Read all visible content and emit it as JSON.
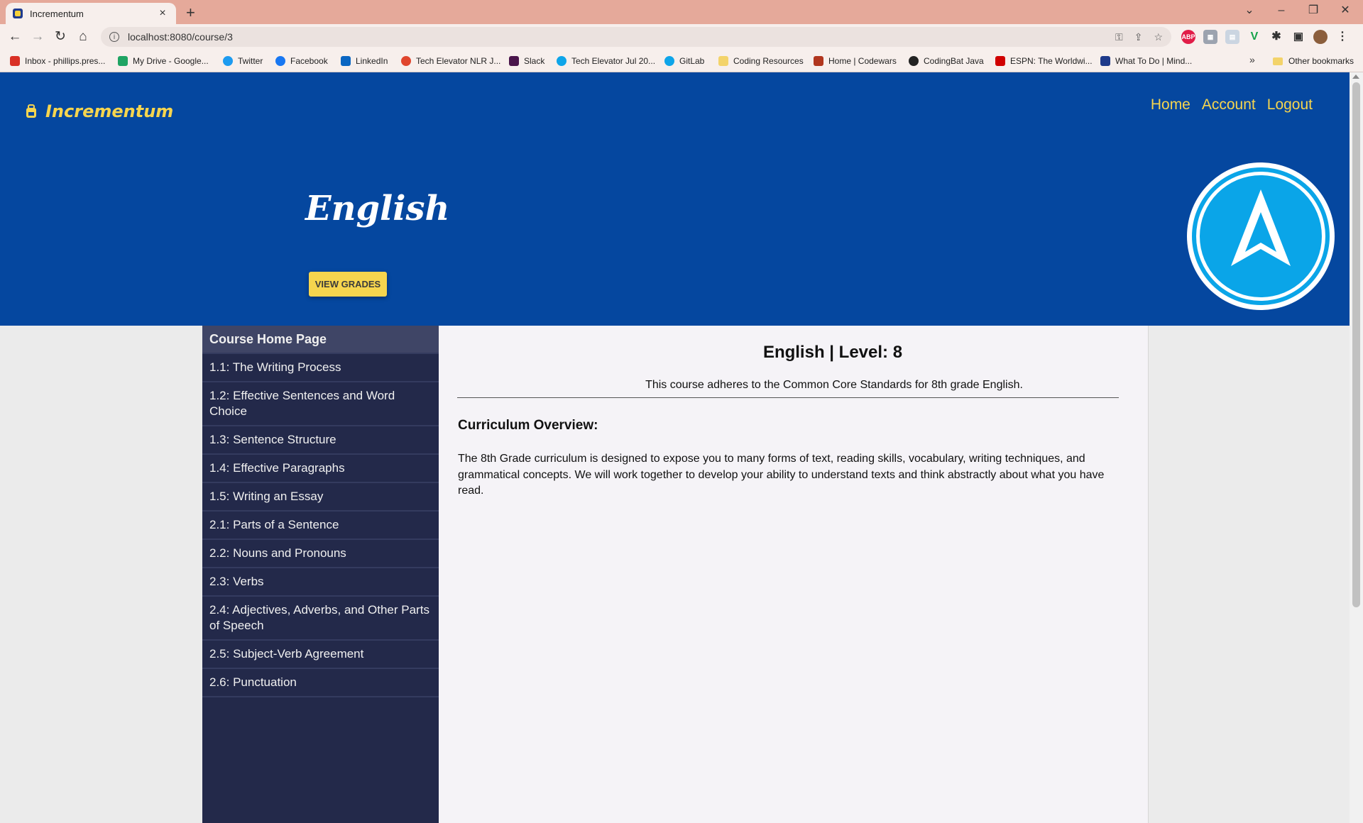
{
  "browser": {
    "tab_title": "Incrementum",
    "tab_close": "×",
    "new_tab": "+",
    "url": "localhost:8080/course/3",
    "bookmarks": [
      {
        "label": "Inbox - phillips.pres...",
        "color": "#d93025"
      },
      {
        "label": "My Drive - Google...",
        "color": "#1fa463"
      },
      {
        "label": "Twitter",
        "color": "#1d9bf0"
      },
      {
        "label": "Facebook",
        "color": "#1877f2"
      },
      {
        "label": "LinkedIn",
        "color": "#0a66c2"
      },
      {
        "label": "Tech Elevator NLR J...",
        "color": "#e0452d"
      },
      {
        "label": "Slack",
        "color": "#4a154b"
      },
      {
        "label": "Tech Elevator Jul 20...",
        "color": "#0ea5e9"
      },
      {
        "label": "GitLab",
        "color": "#0ea5e9"
      },
      {
        "label": "Coding Resources",
        "color": "#f3d36a"
      },
      {
        "label": "Home | Codewars",
        "color": "#b1361e"
      },
      {
        "label": "CodingBat Java",
        "color": "#222222"
      },
      {
        "label": "ESPN: The Worldwi...",
        "color": "#d00000"
      },
      {
        "label": "What To Do | Mind...",
        "color": "#1e3a8a"
      }
    ],
    "bookmarks_more": "»",
    "other_bookmarks": "Other bookmarks"
  },
  "site": {
    "brand": "Incrementum",
    "nav": {
      "home": "Home",
      "account": "Account",
      "logout": "Logout"
    },
    "colors": {
      "header_bg": "#05479f",
      "accent": "#f6d54e",
      "sidebar_bg": "#23294a"
    }
  },
  "course": {
    "title": "English",
    "view_grades": "VIEW GRADES",
    "heading": "English | Level: 8",
    "standard": "This course adheres to the Common Core Standards for 8th grade English.",
    "overview_heading": "Curriculum Overview:",
    "overview_text": "The 8th Grade curriculum is designed to expose you to many forms of text, reading skills, vocabulary, writing techniques, and grammatical concepts. We will work together to develop your ability to understand texts and think abstractly about what you have read."
  },
  "sidebar": {
    "items": [
      {
        "label": "Course Home Page"
      },
      {
        "label": "1.1: The Writing Process"
      },
      {
        "label": "1.2: Effective Sentences and Word Choice"
      },
      {
        "label": "1.3: Sentence Structure"
      },
      {
        "label": "1.4: Effective Paragraphs"
      },
      {
        "label": "1.5: Writing an Essay"
      },
      {
        "label": "2.1: Parts of a Sentence"
      },
      {
        "label": "2.2: Nouns and Pronouns"
      },
      {
        "label": "2.3: Verbs"
      },
      {
        "label": "2.4: Adjectives, Adverbs, and Other Parts of Speech"
      },
      {
        "label": "2.5: Subject-Verb Agreement"
      },
      {
        "label": "2.6: Punctuation"
      }
    ]
  }
}
